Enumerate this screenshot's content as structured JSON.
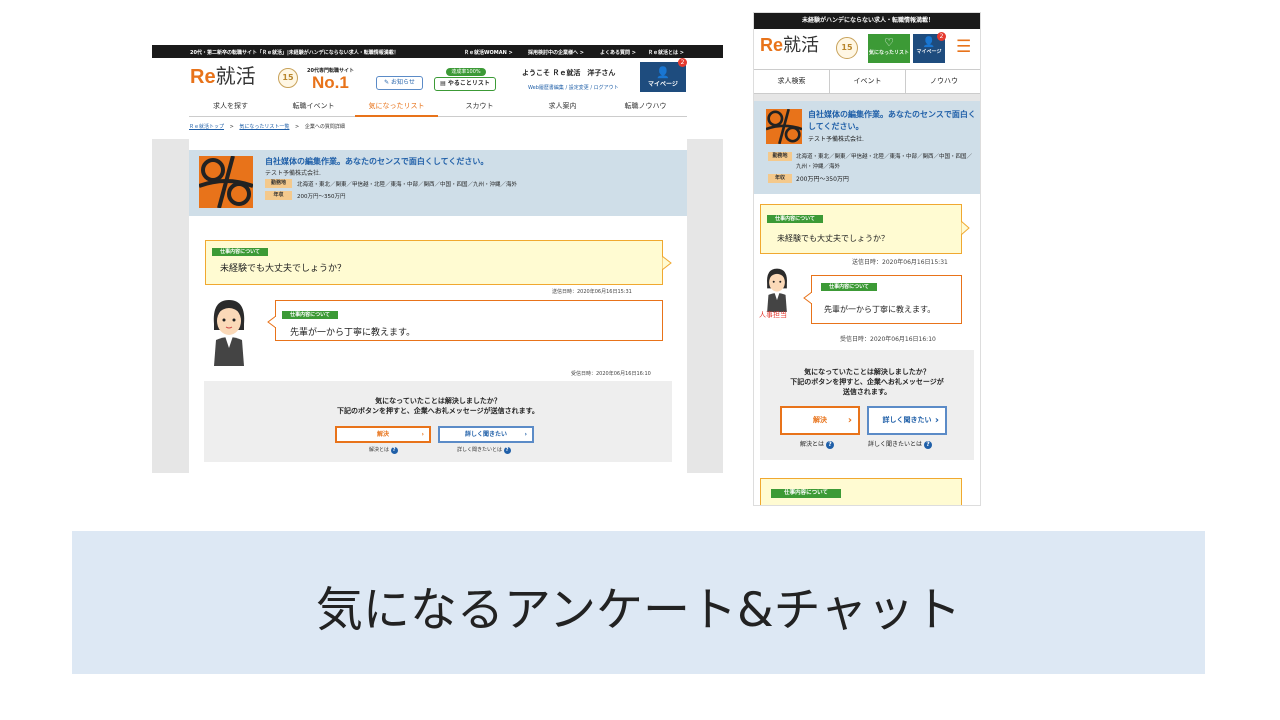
{
  "desktop": {
    "topbar": {
      "tagline": "20代・第二新卒の転職サイト「Ｒｅ就活」|未経験がハンデにならない求人・転職情報満載！",
      "links": [
        "Ｒｅ就活WOMAN >",
        "採用検討中の企業様へ >",
        "よくある質問 >",
        "Ｒｅ就活とは >"
      ]
    },
    "header": {
      "logo_re": "Re",
      "logo_ji": "就活",
      "badge": "15",
      "no1_label": "20代専門転職サイト",
      "no1": "No.1",
      "notice_label": "お知らせ",
      "todo_badge": "達成率100%",
      "todo_label": "やることリスト",
      "welcome": "ようこそ Ｒｅ就活　洋子さん",
      "web_resume": "Web履歴書編集",
      "settings": "設定変更",
      "logout": "ログアウト",
      "mypage": "マイページ",
      "mypage_count": "2"
    },
    "nav": [
      "求人を探す",
      "転職イベント",
      "気になったリスト",
      "スカウト",
      "求人案内",
      "転職ノウハウ"
    ],
    "breadcrumb": [
      "Ｒｅ就活トップ",
      "気になったリスト一覧",
      "企業への質問詳細"
    ],
    "job": {
      "title": "自社媒体の編集作業。あなたのセンスで面白くしてください。",
      "company": "テスト予備株式会社.",
      "loc_tag": "勤務地",
      "loc": "北海道・東北／関東／甲信越・北陸／東海・中部／関西／中国・四国／九州・沖縄／海外",
      "pay_tag": "年収",
      "pay": "200万円～350万円"
    },
    "chat": {
      "q_tag": "仕事内容について",
      "question": "未経験でも大丈夫でしょうか？",
      "q_time": "送信日時：2020年06月16日15:31",
      "a_tag": "仕事内容について",
      "answer": "先輩が一から丁寧に教えます。",
      "a_time": "受信日時：2020年06月16日16:10"
    },
    "resolve": {
      "line1": "気になっていたことは解決しましたか？",
      "line2": "下記のボタンを押すと、企業へお礼メッセージが送信されます。",
      "solve_btn": "解決",
      "ask_btn": "詳しく聞きたい",
      "solve_help": "解決とは",
      "ask_help": "詳しく聞きたいとは"
    }
  },
  "mobile": {
    "topbar": "未経験がハンデにならない求人・転職情報満載！",
    "fav_label": "気になったリスト",
    "mypage": "マイページ",
    "mypage_count": "2",
    "tabs": [
      "求人検索",
      "イベント",
      "ノウハウ"
    ],
    "job": {
      "title": "自社媒体の編集作業。あなたのセンスで面白くしてください。",
      "company": "テスト予備株式会社.",
      "loc_tag": "勤務地",
      "loc": "北海道・東北／関東／甲信越・北陸／東海・中部／関西／中国・四国／九州・沖縄／海外",
      "pay_tag": "年収",
      "pay": "200万円～350万円"
    },
    "chat": {
      "q_tag": "仕事内容について",
      "question": "未経験でも大丈夫でしょうか？",
      "q_time": "送信日時：2020年06月16日15:31",
      "hr_label": "人事担当",
      "a_tag": "仕事内容について",
      "answer": "先輩が一から丁寧に教えます。",
      "a_time": "受信日時：2020年06月16日16:10",
      "next_tag": "仕事内容について"
    },
    "resolve": {
      "line1": "気になっていたことは解決しましたか？",
      "line2": "下記のボタンを押すと、企業へお礼メッセージが",
      "line3": "送信されます。",
      "solve_btn": "解決",
      "ask_btn": "詳しく聞きたい",
      "solve_help": "解決とは",
      "ask_help": "詳しく聞きたいとは"
    }
  },
  "caption": "気になるアンケート&チャット",
  "colors": {
    "accent": "#e8731a",
    "link": "#1f5fa8",
    "job_bg": "#cfdee8",
    "caption_bg": "#dde8f4"
  }
}
